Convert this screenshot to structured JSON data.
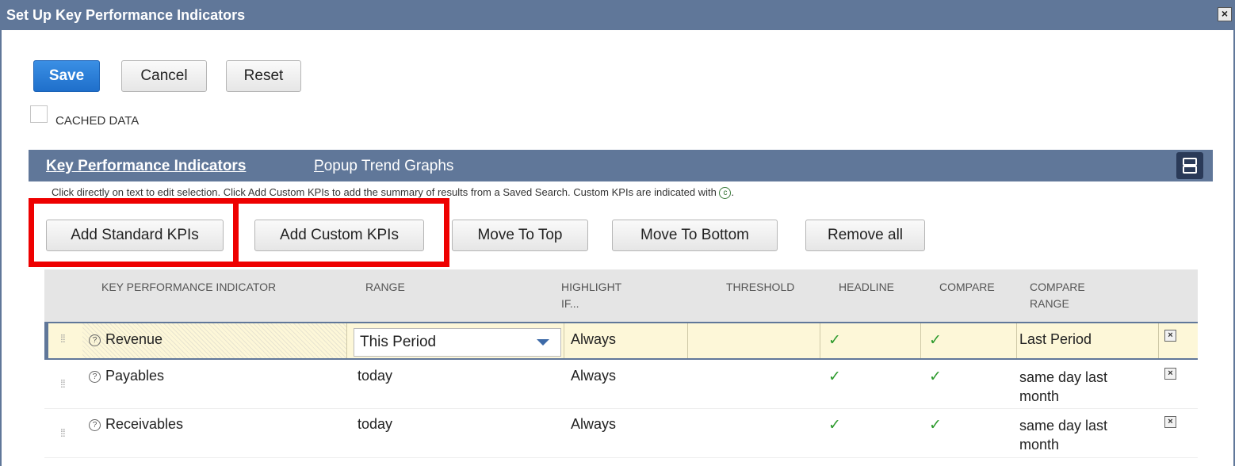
{
  "window": {
    "title": "Set Up Key Performance Indicators",
    "close_icon": "close-icon"
  },
  "toolbar": {
    "save_label": "Save",
    "cancel_label": "Cancel",
    "reset_label": "Reset"
  },
  "cached": {
    "label": "CACHED DATA",
    "checked": false
  },
  "tabs": {
    "kpi": {
      "first": "K",
      "rest": "ey Performance Indicators"
    },
    "trend": {
      "first": "P",
      "rest": "opup Trend Graphs"
    }
  },
  "hint": {
    "text": "Click directly on text to edit selection. Click Add Custom KPIs to add the summary of results from a Saved Search. Custom KPIs are indicated with",
    "custom_marker": "c",
    "end": "."
  },
  "actions": {
    "add_standard": "Add Standard KPIs",
    "add_custom": "Add Custom KPIs",
    "move_top": "Move To Top",
    "move_bottom": "Move To Bottom",
    "remove_all": "Remove all"
  },
  "table": {
    "headers": {
      "kpi": "KEY PERFORMANCE INDICATOR",
      "range": "RANGE",
      "highlight_1": "HIGHLIGHT",
      "highlight_2": "IF...",
      "threshold": "THRESHOLD",
      "headline": "HEADLINE",
      "compare": "COMPARE",
      "compare_range_1": "COMPARE",
      "compare_range_2": "RANGE"
    },
    "rows": [
      {
        "kpi": "Revenue",
        "range": "This Period",
        "highlight": "Always",
        "threshold": "",
        "headline": "✓",
        "compare": "✓",
        "compare_range_1": "Last Period",
        "compare_range_2": ""
      },
      {
        "kpi": "Payables",
        "range": "today",
        "highlight": "Always",
        "threshold": "",
        "headline": "✓",
        "compare": "✓",
        "compare_range_1": "same day last",
        "compare_range_2": "month"
      },
      {
        "kpi": "Receivables",
        "range": "today",
        "highlight": "Always",
        "threshold": "",
        "headline": "✓",
        "compare": "✓",
        "compare_range_1": "same day last",
        "compare_range_2": "month"
      }
    ]
  },
  "colors": {
    "titlebar": "#607799",
    "primary_button": "#1f6fcb",
    "highlight_annotation": "#ee0000",
    "selected_row": "#fdf7d8",
    "check": "#2c9a2c"
  }
}
